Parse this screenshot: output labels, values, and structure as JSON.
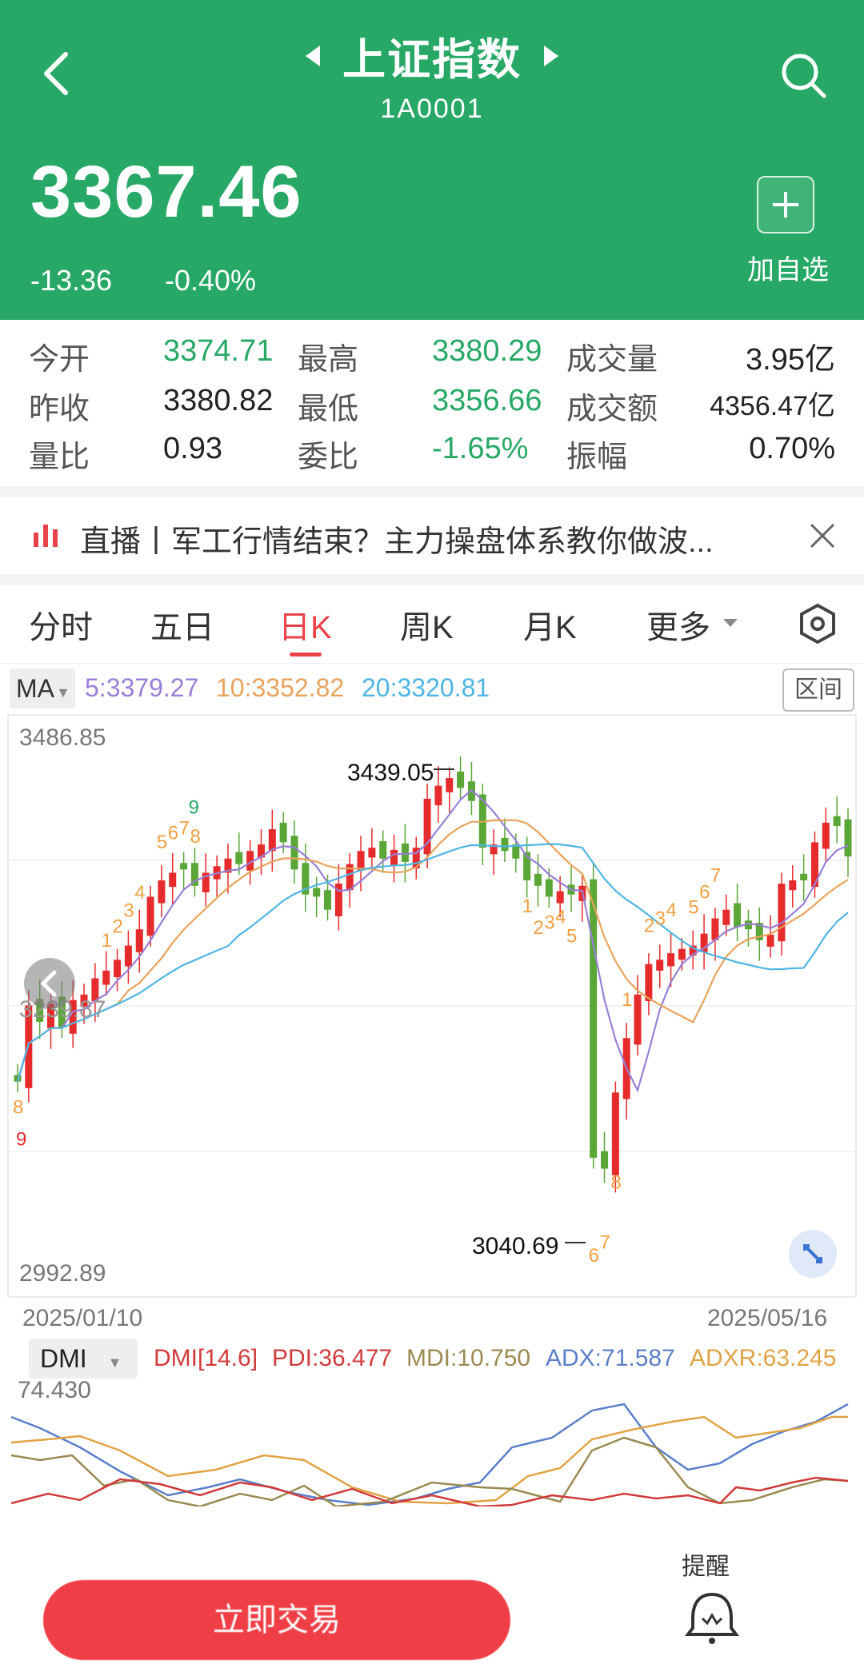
{
  "header": {
    "title": "上证指数",
    "code": "1A0001",
    "price": "3367.46",
    "change": "-13.36",
    "change_pct": "-0.40%",
    "add_label": "加自选",
    "bg_color": "#27a866"
  },
  "quote": {
    "rows": [
      [
        {
          "label": "今开",
          "value": "3374.71"
        },
        {
          "label": "最高",
          "value": "3380.29"
        },
        {
          "label": "成交量",
          "value": "3.95亿"
        }
      ],
      [
        {
          "label": "昨收",
          "value": "3380.82"
        },
        {
          "label": "最低",
          "value": "3356.66"
        },
        {
          "label": "成交额",
          "value": "4356.47亿"
        }
      ],
      [
        {
          "label": "量比",
          "value": "0.93"
        },
        {
          "label": "委比",
          "value": "-1.65%"
        },
        {
          "label": "振幅",
          "value": "0.70%"
        }
      ]
    ]
  },
  "live_banner": {
    "icon": "bar-chart-icon",
    "text": "直播丨军工行情结束？主力操盘体系教你做波..."
  },
  "tabs": {
    "items": [
      "分时",
      "五日",
      "日K",
      "周K",
      "月K",
      "更多"
    ],
    "active": "日K"
  },
  "ma": {
    "selector": "MA",
    "items": [
      {
        "text": "5:3379.27",
        "color": "#9a7fd6"
      },
      {
        "text": "10:3352.82",
        "color": "#e7a35b"
      },
      {
        "text": "20:3320.81",
        "color": "#4fb5e3"
      }
    ],
    "range_button": "区间"
  },
  "chart": {
    "y_top": "3486.85",
    "y_mid": "3239.87",
    "y_bottom": "2992.89",
    "high_annotation": "3439.05",
    "low_annotation": "3040.69",
    "date_start": "2025/01/10",
    "date_end": "2025/05/16"
  },
  "chart_data": {
    "type": "candlestick",
    "yaxis_labels": [
      "3486.85",
      "3239.87",
      "2992.89"
    ],
    "ylim": [
      2992.89,
      3486.85
    ],
    "x_range": [
      "2025/01/10",
      "2025/05/16"
    ],
    "annotations": [
      {
        "label": "3439.05",
        "value": 3439.05,
        "note": "period high"
      },
      {
        "label": "3040.69",
        "value": 3040.69,
        "note": "period low"
      }
    ],
    "candles_close": [
      3160,
      3230,
      3215,
      3232,
      3210,
      3235,
      3240,
      3255,
      3262,
      3272,
      3285,
      3300,
      3330,
      3345,
      3352,
      3355,
      3340,
      3352,
      3358,
      3365,
      3360,
      3372,
      3378,
      3392,
      3380,
      3355,
      3332,
      3330,
      3318,
      3342,
      3360,
      3372,
      3375,
      3365,
      3373,
      3362,
      3375,
      3420,
      3432,
      3439,
      3430,
      3418,
      3375,
      3378,
      3372,
      3365,
      3345,
      3340,
      3330,
      3335,
      3332,
      3340,
      3090,
      3080,
      3150,
      3200,
      3240,
      3268,
      3272,
      3278,
      3282,
      3285,
      3296,
      3310,
      3318,
      3302,
      3300,
      3290,
      3295,
      3342,
      3345,
      3345,
      3380,
      3398,
      3395,
      3367
    ],
    "candles_up": [
      false,
      true,
      false,
      true,
      false,
      true,
      true,
      true,
      true,
      true,
      true,
      true,
      true,
      true,
      true,
      false,
      false,
      true,
      true,
      true,
      false,
      true,
      true,
      true,
      false,
      false,
      false,
      false,
      false,
      true,
      true,
      true,
      true,
      false,
      true,
      false,
      true,
      true,
      true,
      true,
      false,
      false,
      false,
      true,
      false,
      false,
      false,
      false,
      false,
      true,
      false,
      true,
      false,
      false,
      true,
      true,
      true,
      true,
      true,
      true,
      true,
      true,
      true,
      true,
      true,
      false,
      false,
      false,
      true,
      true,
      true,
      false,
      true,
      true,
      false,
      false
    ],
    "td_labels_orange": [
      "8",
      "1",
      "2",
      "3",
      "4",
      "5",
      "6",
      "7",
      "8",
      "1",
      "2",
      "3",
      "4",
      "5",
      "6",
      "7",
      "8",
      "1",
      "2",
      "3",
      "4",
      "5",
      "6",
      "7"
    ],
    "td_labels_red": [
      "9"
    ],
    "td_labels_green": [
      "9"
    ],
    "series": [
      {
        "name": "MA5",
        "color": "#9a7fd6"
      },
      {
        "name": "MA10",
        "color": "#e7a35b"
      },
      {
        "name": "MA20",
        "color": "#4fb5e3"
      }
    ]
  },
  "dmi": {
    "selector": "DMI",
    "params": "DMI[14.6]",
    "pdi": "PDI:36.477",
    "mdi": "MDI:10.750",
    "adx": "ADX:71.587",
    "adxr": "ADXR:63.245",
    "top_value": "74.430",
    "colors": {
      "pdi": "#d03b3b",
      "mdi": "#9b8a52",
      "adx": "#5b7fc8",
      "adxr": "#e0a345"
    }
  },
  "bottom": {
    "buy_label": "立即交易",
    "remind_label": "提醒"
  }
}
